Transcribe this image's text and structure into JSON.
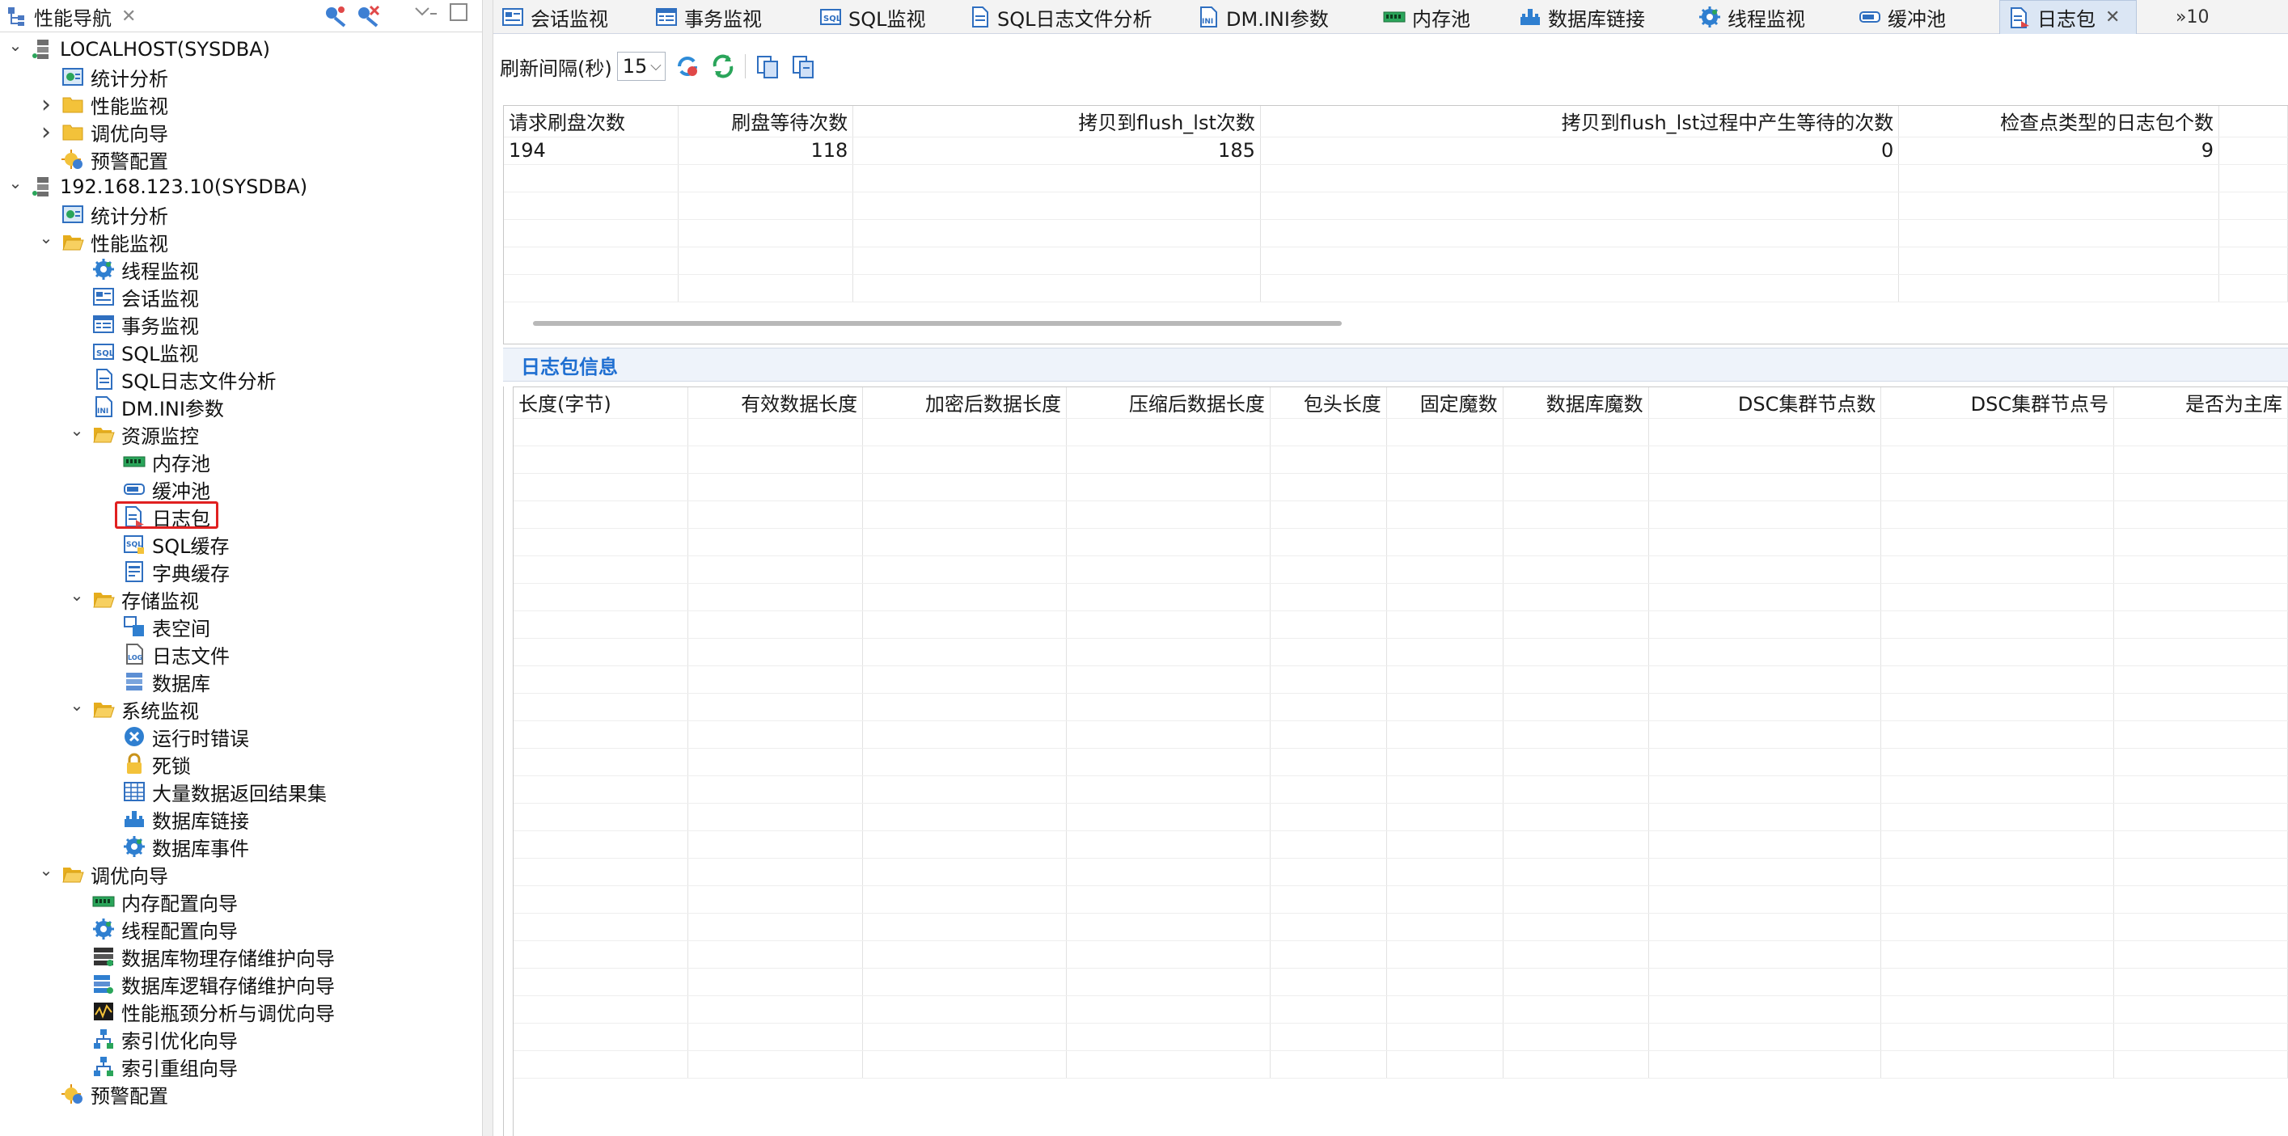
{
  "nav": {
    "title": "性能导航",
    "tree": [
      {
        "label": "LOCALHOST(SYSDBA)",
        "icon": "server-icon",
        "arrow": "v",
        "indent": 0
      },
      {
        "label": "统计分析",
        "icon": "stats-icon",
        "arrow": "",
        "indent": 1
      },
      {
        "label": "性能监视",
        "icon": "folder-icon",
        "arrow": ">",
        "indent": 1
      },
      {
        "label": "调优向导",
        "icon": "folder-icon",
        "arrow": ">",
        "indent": 1
      },
      {
        "label": "预警配置",
        "icon": "alert-config-icon",
        "arrow": "",
        "indent": 1
      },
      {
        "label": "192.168.123.10(SYSDBA)",
        "icon": "server-icon",
        "arrow": "v",
        "indent": 0
      },
      {
        "label": "统计分析",
        "icon": "stats-icon",
        "arrow": "",
        "indent": 1
      },
      {
        "label": "性能监视",
        "icon": "folder-open-icon",
        "arrow": "v",
        "indent": 1
      },
      {
        "label": "线程监视",
        "icon": "gear-icon",
        "arrow": "",
        "indent": 2
      },
      {
        "label": "会话监视",
        "icon": "session-icon",
        "arrow": "",
        "indent": 2
      },
      {
        "label": "事务监视",
        "icon": "transaction-icon",
        "arrow": "",
        "indent": 2
      },
      {
        "label": "SQL监视",
        "icon": "sql-icon",
        "arrow": "",
        "indent": 2
      },
      {
        "label": "SQL日志文件分析",
        "icon": "sql-log-icon",
        "arrow": "",
        "indent": 2
      },
      {
        "label": "DM.INI参数",
        "icon": "ini-icon",
        "arrow": "",
        "indent": 2
      },
      {
        "label": "资源监控",
        "icon": "folder-open-icon",
        "arrow": "v",
        "indent": 2
      },
      {
        "label": "内存池",
        "icon": "memory-icon",
        "arrow": "",
        "indent": 3
      },
      {
        "label": "缓冲池",
        "icon": "buffer-icon",
        "arrow": "",
        "indent": 3
      },
      {
        "label": "日志包",
        "icon": "log-package-icon",
        "arrow": "",
        "indent": 3,
        "selected": true
      },
      {
        "label": "SQL缓存",
        "icon": "sql-cache-icon",
        "arrow": "",
        "indent": 3
      },
      {
        "label": "字典缓存",
        "icon": "dict-cache-icon",
        "arrow": "",
        "indent": 3
      },
      {
        "label": "存储监视",
        "icon": "folder-open-icon",
        "arrow": "v",
        "indent": 2
      },
      {
        "label": "表空间",
        "icon": "tablespace-icon",
        "arrow": "",
        "indent": 3
      },
      {
        "label": "日志文件",
        "icon": "log-file-icon",
        "arrow": "",
        "indent": 3
      },
      {
        "label": "数据库",
        "icon": "database-icon",
        "arrow": "",
        "indent": 3
      },
      {
        "label": "系统监视",
        "icon": "folder-open-icon",
        "arrow": "v",
        "indent": 2
      },
      {
        "label": "运行时错误",
        "icon": "error-icon",
        "arrow": "",
        "indent": 3
      },
      {
        "label": "死锁",
        "icon": "lock-icon",
        "arrow": "",
        "indent": 3
      },
      {
        "label": "大量数据返回结果集",
        "icon": "grid-icon",
        "arrow": "",
        "indent": 3
      },
      {
        "label": "数据库链接",
        "icon": "db-link-icon",
        "arrow": "",
        "indent": 3
      },
      {
        "label": "数据库事件",
        "icon": "gear-icon",
        "arrow": "",
        "indent": 3
      },
      {
        "label": "调优向导",
        "icon": "folder-open-icon",
        "arrow": "v",
        "indent": 1
      },
      {
        "label": "内存配置向导",
        "icon": "memory-icon",
        "arrow": "",
        "indent": 2
      },
      {
        "label": "线程配置向导",
        "icon": "gear-icon",
        "arrow": "",
        "indent": 2
      },
      {
        "label": "数据库物理存储维护向导",
        "icon": "physical-storage-icon",
        "arrow": "",
        "indent": 2
      },
      {
        "label": "数据库逻辑存储维护向导",
        "icon": "logical-storage-icon",
        "arrow": "",
        "indent": 2
      },
      {
        "label": "性能瓶颈分析与调优向导",
        "icon": "bottleneck-icon",
        "arrow": "",
        "indent": 2
      },
      {
        "label": "索引优化向导",
        "icon": "index-icon",
        "arrow": "",
        "indent": 2
      },
      {
        "label": "索引重组向导",
        "icon": "index-icon",
        "arrow": "",
        "indent": 2
      },
      {
        "label": "预警配置",
        "icon": "alert-config-icon",
        "arrow": "",
        "indent": 1
      }
    ]
  },
  "tabs": [
    {
      "label": "会话监视",
      "icon": "session-icon"
    },
    {
      "label": "事务监视",
      "icon": "transaction-icon"
    },
    {
      "label": "SQL监视",
      "icon": "sql-icon"
    },
    {
      "label": "SQL日志文件分析",
      "icon": "sql-log-icon"
    },
    {
      "label": "DM.INI参数",
      "icon": "ini-icon"
    },
    {
      "label": "内存池",
      "icon": "memory-icon"
    },
    {
      "label": "数据库链接",
      "icon": "db-link-icon"
    },
    {
      "label": "线程监视",
      "icon": "gear-icon"
    },
    {
      "label": "缓冲池",
      "icon": "buffer-icon"
    },
    {
      "label": "日志包",
      "icon": "log-package-icon",
      "active": true
    }
  ],
  "tab_overflow": "»10",
  "toolbar": {
    "interval_label": "刷新间隔(秒)",
    "interval_value": "15"
  },
  "stats_table": {
    "headers": [
      "请求刷盘次数",
      "刷盘等待次数",
      "拷贝到flush_lst次数",
      "拷贝到flush_lst过程中产生等待的次数",
      "检查点类型的日志包个数"
    ],
    "row": [
      "194",
      "118",
      "185",
      "0",
      "9"
    ]
  },
  "section_title": "日志包信息",
  "detail_table": {
    "headers": [
      "长度(字节)",
      "有效数据长度",
      "加密后数据长度",
      "压缩后数据长度",
      "包头长度",
      "固定魔数",
      "数据库魔数",
      "DSC集群节点数",
      "DSC集群节点号",
      "是否为主库"
    ]
  },
  "colors": {
    "accent": "#1f6fd1",
    "selection": "#e02020",
    "active_tab": "#dbe6f4"
  }
}
